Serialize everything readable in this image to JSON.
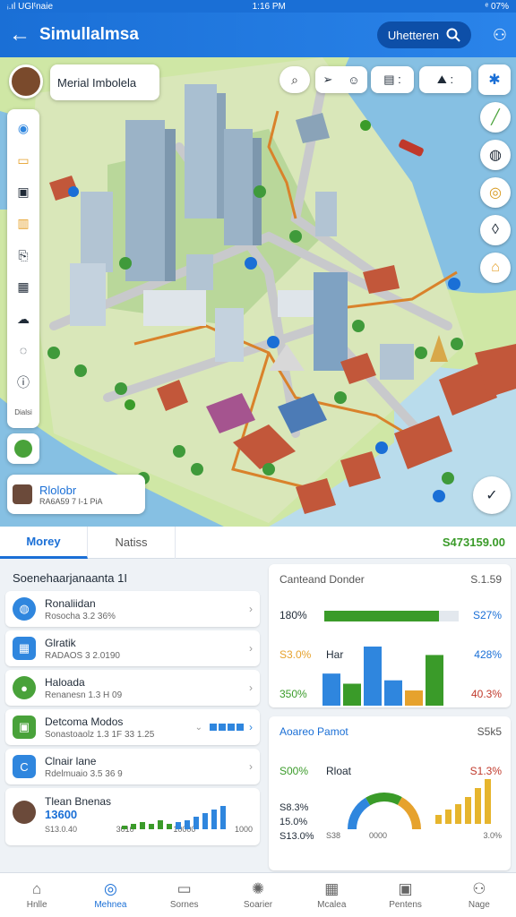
{
  "status": {
    "left": "ᵢ.ıl UGIᵗnaie",
    "time": "1:16 PM",
    "right": "ᵉ 07%"
  },
  "appbar": {
    "back_icon": "arrow-left-icon",
    "title": "Simullalmsa",
    "search_label": "Uhetteren",
    "user_icon": "user-icon"
  },
  "map": {
    "profile_card": {
      "name": "Merial Imbolela"
    },
    "bottom_card": {
      "title": "Rlolobr",
      "subtitle": "RA6A59 7 I-1 PiA"
    },
    "top_tools": [
      "pin-icon",
      "navigation-icon",
      "smile-icon",
      "note-icon",
      "route-icon"
    ],
    "right_tools": [
      "brush-icon",
      "globe-icon",
      "coin-icon",
      "drop-icon",
      "warehouse-icon"
    ],
    "left_tools": [
      "sun-icon",
      "folder-icon",
      "image-icon",
      "chart-icon",
      "clip-icon",
      "calendar-icon",
      "cloud-icon",
      "chat-icon",
      "info-icon"
    ],
    "left_tools_caption": "Dialsi"
  },
  "tabs": [
    "Morey",
    "Natiss"
  ],
  "balance": "S473159.00",
  "list": {
    "header": "Soenehaarjanaanta 1I",
    "rows": [
      {
        "title": "Ronaliidan",
        "sub": "Rosocha 3.2 36%",
        "icon": "globe-icon",
        "color": "#2f86de"
      },
      {
        "title": "Glratik",
        "sub": "RADAOS 3 2.0190",
        "icon": "grid-icon",
        "color": "#2f86de"
      },
      {
        "title": "Haloada",
        "sub": "Renanesn 1.3 H 09",
        "icon": "leaf-icon",
        "color": "#49a23a"
      },
      {
        "title": "Detcoma Modos",
        "sub": "Sonastoaolz 1.3 1F 33 1.25",
        "icon": "shop-icon",
        "color": "#49a23a"
      },
      {
        "title": "Clnair lane",
        "sub": "Rdelmuaio 3.5 36 9",
        "icon": "c-icon",
        "color": "#2f86de"
      },
      {
        "title": "Tlean Bnenas",
        "sub": "13600",
        "icon": "person-avatar",
        "color": "#6b4a3a"
      }
    ],
    "last_row_ticks": [
      "S13.0.40",
      "3010",
      "10000",
      "1000"
    ]
  },
  "right": {
    "card1": {
      "title": "Canteand Donder",
      "value": "S.1.59",
      "bar_row_left": "180%",
      "bar_row_right": "S27%",
      "bar_fill": 0.85,
      "left_labels": [
        "S3.0%",
        "350%"
      ],
      "mid_label": "Har",
      "right_labels": [
        "428%",
        "40.3%"
      ],
      "bars": [
        38,
        26,
        70,
        30,
        18,
        60
      ]
    },
    "card2": {
      "title": "Aoareo Pamot",
      "value": "S5k5",
      "left_labels": [
        "S00%",
        "S8.3%",
        "15.0%",
        "S13.0%"
      ],
      "mid_label": "Rloat",
      "right_label": "S1.3%",
      "bottom_labels": [
        "S38",
        "0000",
        "3.0%"
      ],
      "gauge": 0.62,
      "mini_bars": [
        10,
        16,
        22,
        30,
        40,
        50
      ]
    }
  },
  "nav": [
    {
      "label": "Hnlle",
      "icon": "home-icon"
    },
    {
      "label": "Mehnea",
      "icon": "search-icon"
    },
    {
      "label": "Sornes",
      "icon": "store-icon"
    },
    {
      "label": "Soarier",
      "icon": "gear-icon"
    },
    {
      "label": "Mcalea",
      "icon": "calendar-icon"
    },
    {
      "label": "Pentens",
      "icon": "gift-icon"
    },
    {
      "label": "Nage",
      "icon": "user-icon"
    }
  ],
  "colors": {
    "primary": "#1a6fd6",
    "green": "#3a9b29",
    "orange": "#e6a22d",
    "red": "#c0392b"
  }
}
